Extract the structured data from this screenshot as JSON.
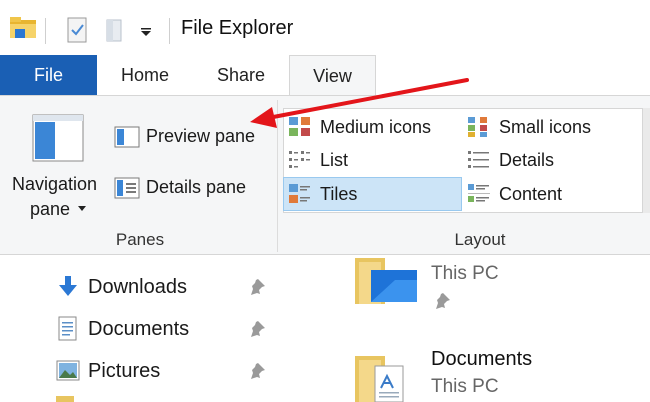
{
  "window": {
    "title": "File Explorer"
  },
  "tabs": [
    {
      "label": "File"
    },
    {
      "label": "Home"
    },
    {
      "label": "Share"
    },
    {
      "label": "View"
    }
  ],
  "ribbon": {
    "panes": {
      "navigation_pane": "Navigation",
      "navigation_pane_line2": "pane",
      "preview_pane": "Preview pane",
      "details_pane": "Details pane",
      "group_label": "Panes"
    },
    "layout": {
      "options": [
        {
          "label": "Medium icons"
        },
        {
          "label": "Small icons"
        },
        {
          "label": "List"
        },
        {
          "label": "Details"
        },
        {
          "label": "Tiles"
        },
        {
          "label": "Content"
        }
      ],
      "group_label": "Layout"
    }
  },
  "navigation": {
    "items": [
      {
        "label": "Downloads"
      },
      {
        "label": "Documents"
      },
      {
        "label": "Pictures"
      }
    ]
  },
  "content": {
    "items": [
      {
        "title": "",
        "subtitle": "This PC"
      },
      {
        "title": "Documents",
        "subtitle": "This PC"
      }
    ]
  },
  "colors": {
    "accent": "#1a5fb4",
    "annotation_arrow": "#e3151a",
    "selection": "#cce4f7"
  }
}
